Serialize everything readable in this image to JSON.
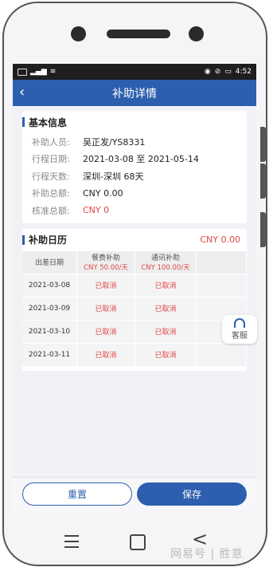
{
  "status_bar": {
    "time": "4:52",
    "battery": "▭"
  },
  "header": {
    "title": "补助详情",
    "back_icon": "chevron-left-icon"
  },
  "basic_info": {
    "section_title": "基本信息",
    "rows": [
      {
        "label": "补助人员:",
        "value": "吴正发/YS8331"
      },
      {
        "label": "行程日期:",
        "value": "2021-03-08 至 2021-05-14"
      },
      {
        "label": "行程天数:",
        "value": "深圳-深圳  68天"
      },
      {
        "label": "补助总额:",
        "value": "CNY 0.00"
      },
      {
        "label": "核准总额:",
        "value": "CNY 0"
      }
    ]
  },
  "calendar": {
    "section_title": "补助日历",
    "total": "CNY 0.00",
    "columns": [
      {
        "label": "出差日期",
        "sub": ""
      },
      {
        "label": "餐费补助",
        "sub": "CNY 50.00/天"
      },
      {
        "label": "通讯补助",
        "sub": "CNY 100.00/天"
      }
    ],
    "rows": [
      {
        "date": "2021-03-08",
        "meal": "已取消",
        "comm": "已取消"
      },
      {
        "date": "2021-03-09",
        "meal": "已取消",
        "comm": "已取消"
      },
      {
        "date": "2021-03-10",
        "meal": "已取消",
        "comm": "已取消"
      },
      {
        "date": "2021-03-11",
        "meal": "已取消",
        "comm": "已取消"
      }
    ]
  },
  "service": {
    "label": "客服"
  },
  "footer": {
    "reset_label": "重置",
    "save_label": "保存"
  },
  "watermark": "网易号 | 胜意"
}
